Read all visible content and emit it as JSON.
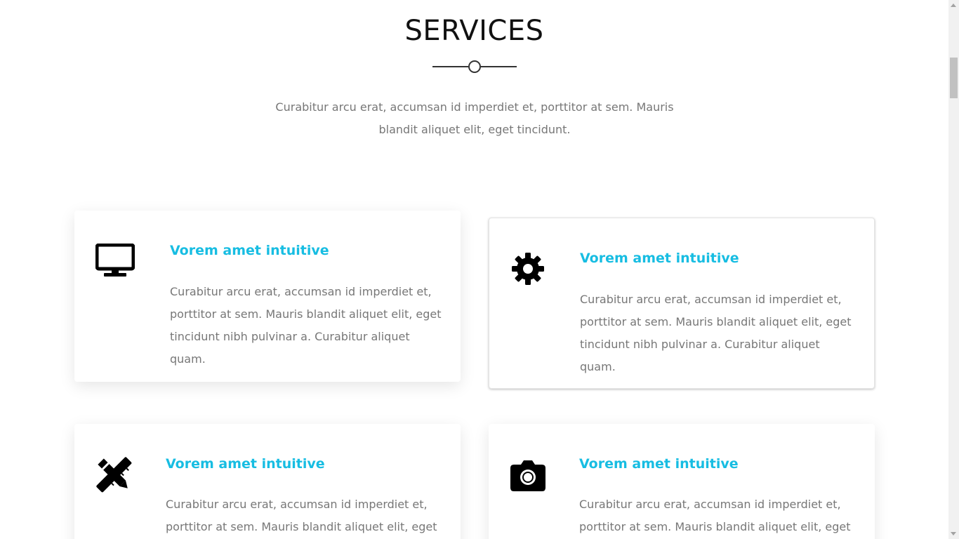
{
  "section": {
    "title": "SERVICES",
    "intro": "Curabitur arcu erat, accumsan id imperdiet et, porttitor at sem. Mauris blandit aliquet elit, eget tincidunt."
  },
  "services": [
    {
      "icon": "desktop-icon",
      "title": "Vorem amet intuitive",
      "text": "Curabitur arcu erat, accumsan id imperdiet et, porttitor at sem. Mauris blandit aliquet elit, eget tincidunt nibh pulvinar a. Curabitur aliquet quam."
    },
    {
      "icon": "gear-icon",
      "title": "Vorem amet intuitive",
      "text": "Curabitur arcu erat, accumsan id imperdiet et, porttitor at sem. Mauris blandit aliquet elit, eget tincidunt nibh pulvinar a. Curabitur aliquet quam."
    },
    {
      "icon": "pencil-ruler-icon",
      "title": "Vorem amet intuitive",
      "text": "Curabitur arcu erat, accumsan id imperdiet et, porttitor at sem. Mauris blandit aliquet elit, eget"
    },
    {
      "icon": "camera-icon",
      "title": "Vorem amet intuitive",
      "text": "Curabitur arcu erat, accumsan id imperdiet et, porttitor at sem. Mauris blandit aliquet elit, eget"
    }
  ],
  "colors": {
    "accent": "#17bde2",
    "body_text": "#777777",
    "heading": "#111111"
  }
}
